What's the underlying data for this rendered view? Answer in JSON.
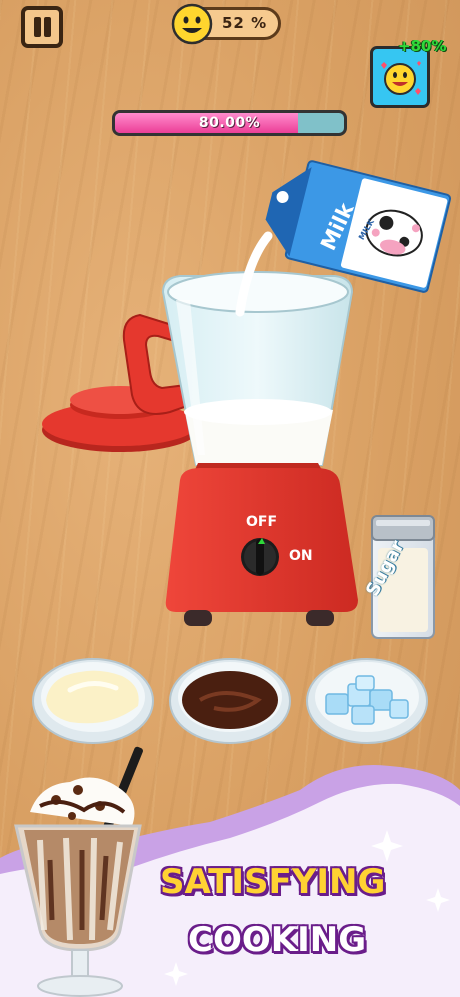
{
  "hud": {
    "pause_icon": "pause-icon",
    "mood_percent": "52 %",
    "mood_icon": "smiley-face-icon",
    "bonus_text": "+80%",
    "bonus_icon": "smiley-hearts-icon"
  },
  "progress": {
    "label": "80.00%",
    "fraction": 0.8
  },
  "blender": {
    "off_label": "OFF",
    "on_label": "ON"
  },
  "milk_carton": {
    "label": "Milk",
    "small_label": "MILK"
  },
  "sugar_jar": {
    "label": "Sugar"
  },
  "ingredients": [
    {
      "name": "cream",
      "icon": "cream-bowl-icon"
    },
    {
      "name": "chocolate",
      "icon": "chocolate-bowl-icon"
    },
    {
      "name": "ice",
      "icon": "ice-bowl-icon"
    }
  ],
  "promo": {
    "line1": "SATISFYING",
    "line2": "COOKING"
  },
  "colors": {
    "accent_pink": "#ec3f97",
    "blender_red": "#e0352a",
    "banner_purple": "#c9a2e6",
    "promo_yellow": "#ffd233",
    "bonus_green": "#2fd93a"
  }
}
